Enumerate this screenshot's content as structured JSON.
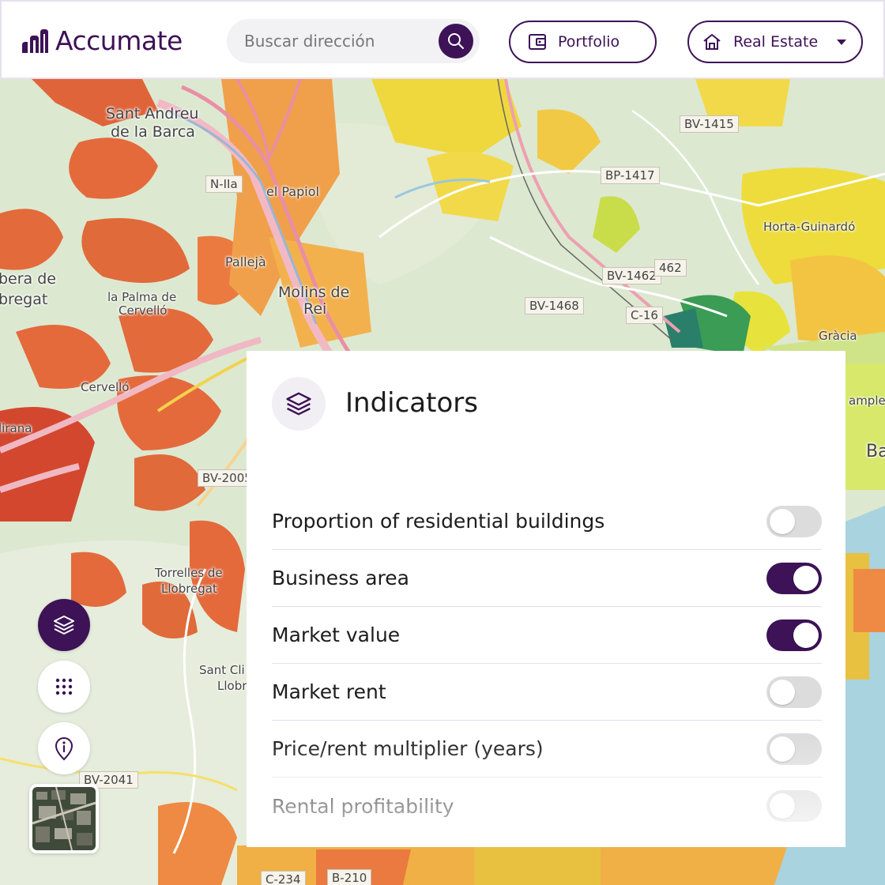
{
  "brand": {
    "name": "Accumate",
    "color": "#3d1257"
  },
  "header": {
    "search_placeholder": "Buscar dirección",
    "portfolio_label": "Portfolio",
    "real_estate_label": "Real Estate"
  },
  "map": {
    "places": [
      "Sant Andreu",
      "de la Barca",
      "el Papiol",
      "Pallejà",
      "Molins de",
      "Rei",
      "bera de",
      "bregat",
      "la Palma de",
      "Cervelló",
      "Cervelló",
      "lirana",
      "Torrelles de",
      "Llobregat",
      "Sant Cli",
      "Llobr",
      "Horta-Guinardó",
      "Gràcia",
      "ample",
      "Ba"
    ],
    "roads": [
      "N-IIa",
      "BV-1415",
      "BP-1417",
      "BV-1462",
      "462",
      "BV-1468",
      "C-16",
      "BV-2005",
      "BV-2041",
      "C-234",
      "B-210"
    ]
  },
  "panel": {
    "title": "Indicators",
    "indicators": [
      {
        "label": "Proportion of residential buildings",
        "on": false
      },
      {
        "label": "Business area",
        "on": true
      },
      {
        "label": "Market value",
        "on": true
      },
      {
        "label": "Market rent",
        "on": false
      },
      {
        "label": "Price/rent multiplier (years)",
        "on": false
      },
      {
        "label": "Rental profitability",
        "on": false
      }
    ]
  },
  "controls": {
    "layers_icon": "layers-icon",
    "grid_icon": "grid-icon",
    "info_icon": "info-pin-icon",
    "satellite_icon": "satellite-thumbnail"
  }
}
